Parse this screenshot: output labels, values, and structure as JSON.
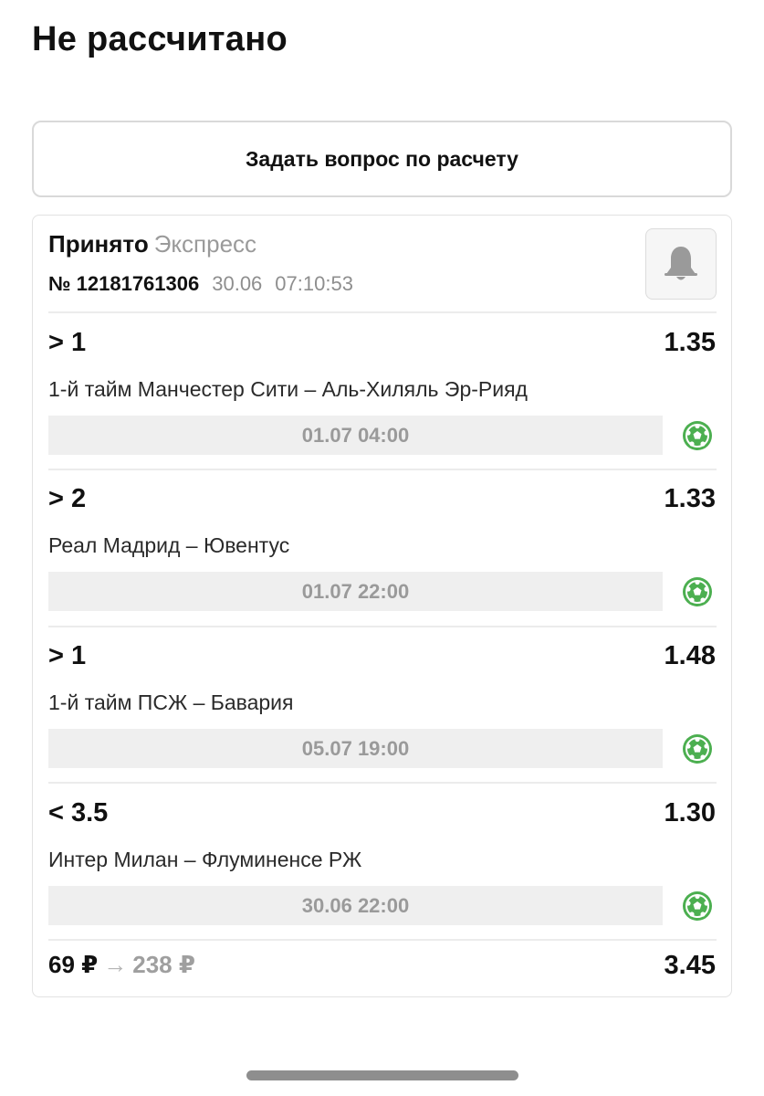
{
  "page": {
    "title": "Не рассчитано"
  },
  "ask_button": {
    "label": "Задать вопрос по расчету"
  },
  "bet": {
    "status": "Принято",
    "type": "Экспресс",
    "number": "№ 12181761306",
    "date": "30.06",
    "time": "07:10:53",
    "bell_icon": "bell-icon",
    "events": [
      {
        "outcome": "> 1",
        "odds": "1.35",
        "match": "1-й тайм Манчестер Сити – Аль-Хиляль Эр-Рияд",
        "start": "01.07 04:00",
        "sport_icon": "football-icon"
      },
      {
        "outcome": "> 2",
        "odds": "1.33",
        "match": "Реал Мадрид – Ювентус",
        "start": "01.07 22:00",
        "sport_icon": "football-icon"
      },
      {
        "outcome": "> 1",
        "odds": "1.48",
        "match": "1-й тайм ПСЖ – Бавария",
        "start": "05.07 19:00",
        "sport_icon": "football-icon"
      },
      {
        "outcome": "< 3.5",
        "odds": "1.30",
        "match": "Интер Милан – Флуминенсе РЖ",
        "start": "30.06 22:00",
        "sport_icon": "football-icon"
      }
    ],
    "stake": "69 ₽",
    "arrow": "→",
    "potential_payout": "238 ₽",
    "total_odds": "3.45"
  },
  "colors": {
    "accent_green": "#4caf50",
    "muted_text": "#9a9a9a",
    "time_bar_bg": "#efefef"
  }
}
